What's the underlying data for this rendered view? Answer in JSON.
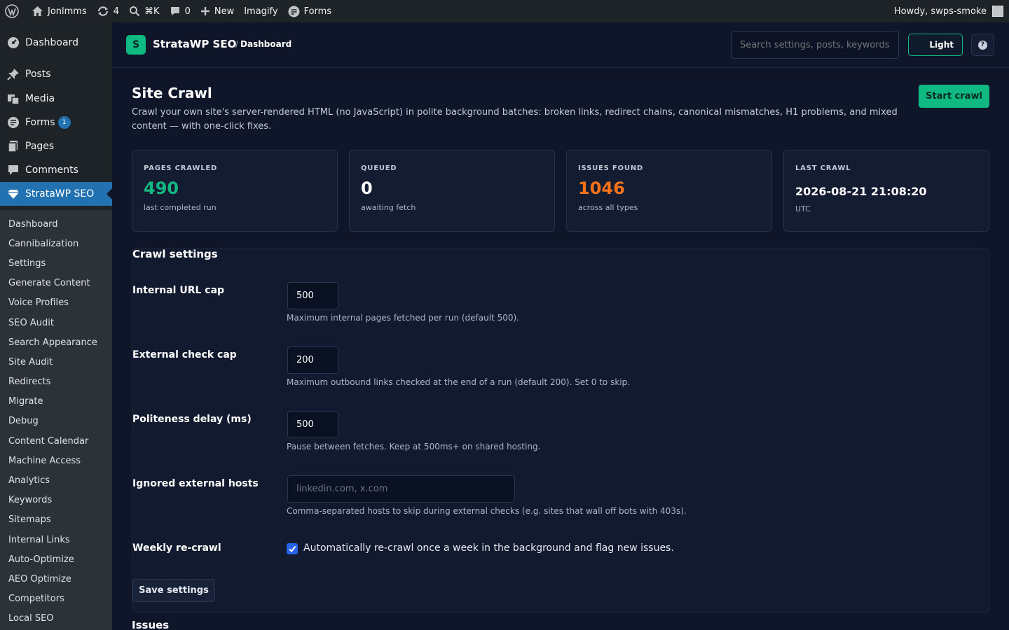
{
  "admin_bar": {
    "site_name": "Jonlmms",
    "updates_count": "4",
    "search_shortcut": "⌘K",
    "comments_count": "0",
    "new_label": "New",
    "imagify_label": "Imagify",
    "forms_label": "Forms",
    "greeting": "Howdy, swps-smoke"
  },
  "sidebar": {
    "items": [
      {
        "label": "Dashboard",
        "icon": "dashboard-icon"
      },
      {
        "label": "Posts",
        "icon": "pin-icon"
      },
      {
        "label": "Media",
        "icon": "media-icon"
      },
      {
        "label": "Forms",
        "icon": "forms-icon",
        "badge": "1"
      },
      {
        "label": "Pages",
        "icon": "pages-icon"
      },
      {
        "label": "Comments",
        "icon": "comment-icon"
      },
      {
        "label": "StrataWP SEO",
        "icon": "diamond-icon",
        "current": true
      }
    ],
    "submenu": [
      "Dashboard",
      "Cannibalization",
      "Settings",
      "Generate Content",
      "Voice Profiles",
      "SEO Audit",
      "Search Appearance",
      "Site Audit",
      "Redirects",
      "Migrate",
      "Debug",
      "Content Calendar",
      "Machine Access",
      "Analytics",
      "Keywords",
      "Sitemaps",
      "Internal Links",
      "Auto-Optimize",
      "AEO Optimize",
      "Competitors",
      "Local SEO"
    ]
  },
  "header": {
    "logo_letter": "S",
    "brand": "StrataWP SEO",
    "breadcrumb_sep": "/",
    "breadcrumb": "Dashboard",
    "search_placeholder": "Search settings, posts, keywords",
    "theme_toggle": "Light",
    "help_icon_text": "?"
  },
  "main": {
    "title": "Site Crawl",
    "description": "Crawl your own site's server-rendered HTML (no JavaScript) in polite background batches: broken links, redirect chains, canonical mismatches, H1 problems, and mixed content — with one-click fixes.",
    "start_button": "Start crawl"
  },
  "stats": [
    {
      "label": "PAGES CRAWLED",
      "value": "490",
      "sub": "last completed run",
      "color": "#10b981"
    },
    {
      "label": "QUEUED",
      "value": "0",
      "sub": "awaiting fetch",
      "color": "#ffffff"
    },
    {
      "label": "ISSUES FOUND",
      "value": "1046",
      "sub": "across all types",
      "color": "#f97316"
    },
    {
      "label": "LAST CRAWL",
      "value": "2026-08-21 21:08:20",
      "sub": "UTC",
      "color": "#ffffff"
    }
  ],
  "settings": {
    "title": "Crawl settings",
    "fields": [
      {
        "label": "Internal URL cap",
        "value": "500",
        "help": "Maximum internal pages fetched per run (default 500)."
      },
      {
        "label": "External check cap",
        "value": "200",
        "help": "Maximum outbound links checked at the end of a run (default 200). Set 0 to skip."
      },
      {
        "label": "Politeness delay (ms)",
        "value": "500",
        "help": "Pause between fetches. Keep at 500ms+ on shared hosting."
      },
      {
        "label": "Ignored external hosts",
        "placeholder": "linkedin.com, x.com",
        "help": "Comma-separated hosts to skip during external checks (e.g. sites that wall off bots with 403s)."
      }
    ],
    "weekly": {
      "label": "Weekly re-crawl",
      "checked": true,
      "text": "Automatically re-crawl once a week in the background and flag new issues."
    },
    "save_button": "Save settings"
  },
  "issues": {
    "title": "Issues"
  }
}
